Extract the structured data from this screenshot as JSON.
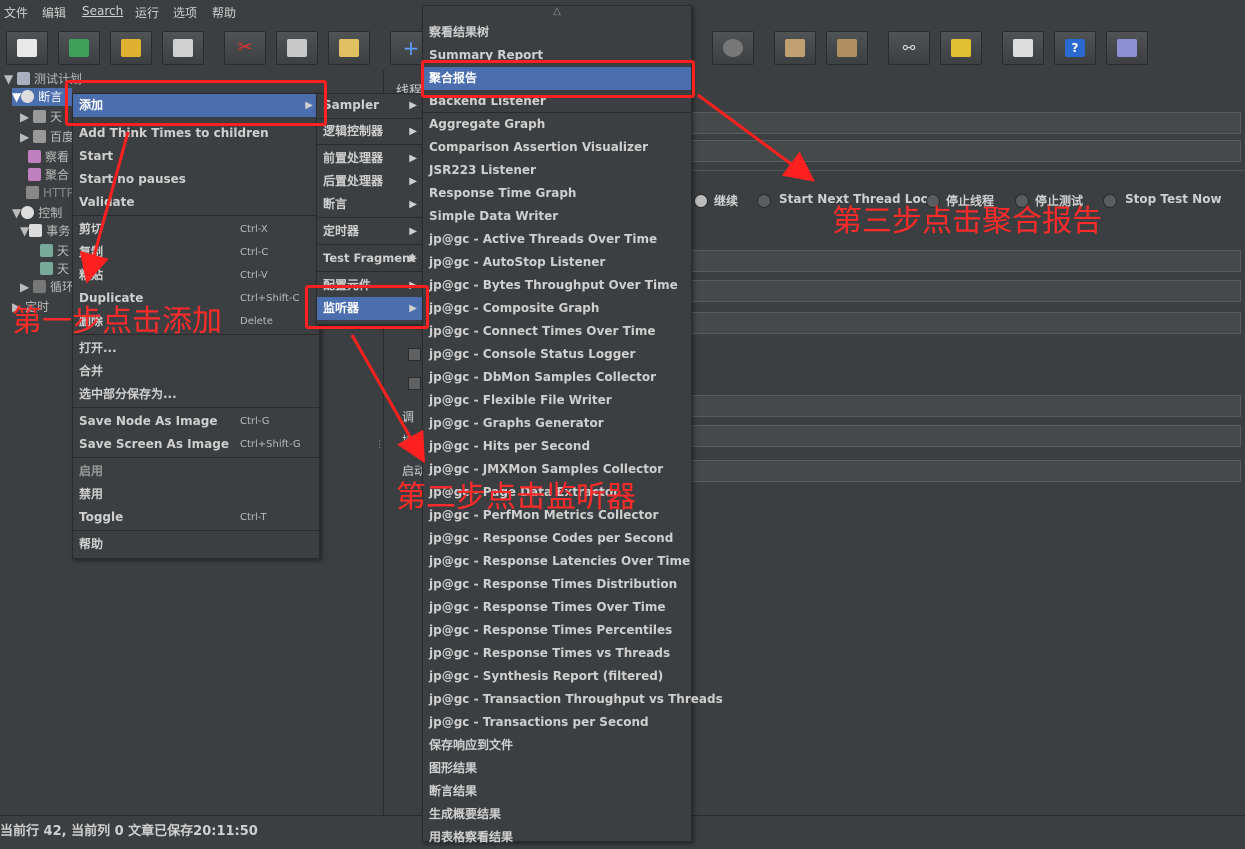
{
  "menubar": [
    "文件",
    "编辑",
    "Search",
    "运行",
    "选项",
    "帮助"
  ],
  "colors": {
    "accent": "#4b6eaf",
    "annotation": "#ff2020",
    "background": "#3c3f41"
  },
  "toolbar_icons": [
    "new-icon",
    "templates-icon",
    "open-icon",
    "save-icon",
    "cut-icon",
    "copy-icon",
    "paste-icon",
    "expand-icon",
    "start-icon",
    "stop-icon",
    "clear-icon",
    "clear-all-icon",
    "search-icon",
    "broom-icon",
    "function-helper-icon",
    "help-icon",
    "remote-icon"
  ],
  "tree": {
    "items": [
      "测试计划",
      "断言",
      "天",
      "百度",
      "察看",
      "聚合",
      "HTTP",
      "控制",
      "事务",
      "天",
      "天",
      "循环",
      "定时"
    ]
  },
  "context_menu": {
    "items": [
      {
        "label": "添加",
        "shortcut": ""
      },
      {
        "label": "Add Think Times to children",
        "shortcut": ""
      },
      {
        "label": "Start",
        "shortcut": ""
      },
      {
        "label": "Start no pauses",
        "shortcut": ""
      },
      {
        "label": "Validate",
        "shortcut": ""
      },
      {
        "label": "剪切",
        "shortcut": "Ctrl-X"
      },
      {
        "label": "复制",
        "shortcut": "Ctrl-C"
      },
      {
        "label": "粘贴",
        "shortcut": "Ctrl-V"
      },
      {
        "label": "Duplicate",
        "shortcut": "Ctrl+Shift-C"
      },
      {
        "label": "删除",
        "shortcut": "Delete"
      },
      {
        "label": "打开...",
        "shortcut": ""
      },
      {
        "label": "合并",
        "shortcut": ""
      },
      {
        "label": "选中部分保存为...",
        "shortcut": ""
      },
      {
        "label": "Save Node As Image",
        "shortcut": "Ctrl-G"
      },
      {
        "label": "Save Screen As Image",
        "shortcut": "Ctrl+Shift-G"
      },
      {
        "label": "启用",
        "shortcut": ""
      },
      {
        "label": "禁用",
        "shortcut": ""
      },
      {
        "label": "Toggle",
        "shortcut": "Ctrl-T"
      },
      {
        "label": "帮助",
        "shortcut": ""
      }
    ]
  },
  "add_submenu": {
    "items": [
      "Sampler",
      "逻辑控制器",
      "前置处理器",
      "后置处理器",
      "断言",
      "定时器",
      "Test Fragment",
      "配置元件",
      "监听器"
    ]
  },
  "listener_submenu": {
    "scroll_up": "△",
    "items": [
      "察看结果树",
      "Summary Report",
      "聚合报告",
      "Backend Listener",
      "Aggregate Graph",
      "Comparison Assertion Visualizer",
      "JSR223 Listener",
      "Response Time Graph",
      "Simple Data Writer",
      "jp@gc - Active Threads Over Time",
      "jp@gc - AutoStop Listener",
      "jp@gc - Bytes Throughput Over Time",
      "jp@gc - Composite Graph",
      "jp@gc - Connect Times Over Time",
      "jp@gc - Console Status Logger",
      "jp@gc - DbMon Samples Collector",
      "jp@gc - Flexible File Writer",
      "jp@gc - Graphs Generator",
      "jp@gc - Hits per Second",
      "jp@gc - JMXMon Samples Collector",
      "jp@gc - Page Data Extractor",
      "jp@gc - PerfMon Metrics Collector",
      "jp@gc - Response Codes per Second",
      "jp@gc - Response Latencies Over Time",
      "jp@gc - Response Times Distribution",
      "jp@gc - Response Times Over Time",
      "jp@gc - Response Times Percentiles",
      "jp@gc - Response Times vs Threads",
      "jp@gc - Synthesis Report (filtered)",
      "jp@gc - Transaction Throughput vs Threads",
      "jp@gc - Transactions per Second",
      "保存响应到文件",
      "图形结果",
      "断言结果",
      "生成概要结果",
      "用表格察看结果"
    ]
  },
  "right_panel": {
    "title": "线程",
    "radio_options": [
      "继续",
      "Start Next Thread Loop",
      "停止线程",
      "停止测试",
      "Stop Test Now"
    ],
    "labels": [
      "调",
      "持",
      "启动"
    ]
  },
  "annotations": {
    "step1": "第一步点击添加",
    "step2": "第二步点击监听器",
    "step3": "第三步点击聚合报告"
  },
  "status": "当前行 42, 当前列 0  文章已保存20:11:50"
}
